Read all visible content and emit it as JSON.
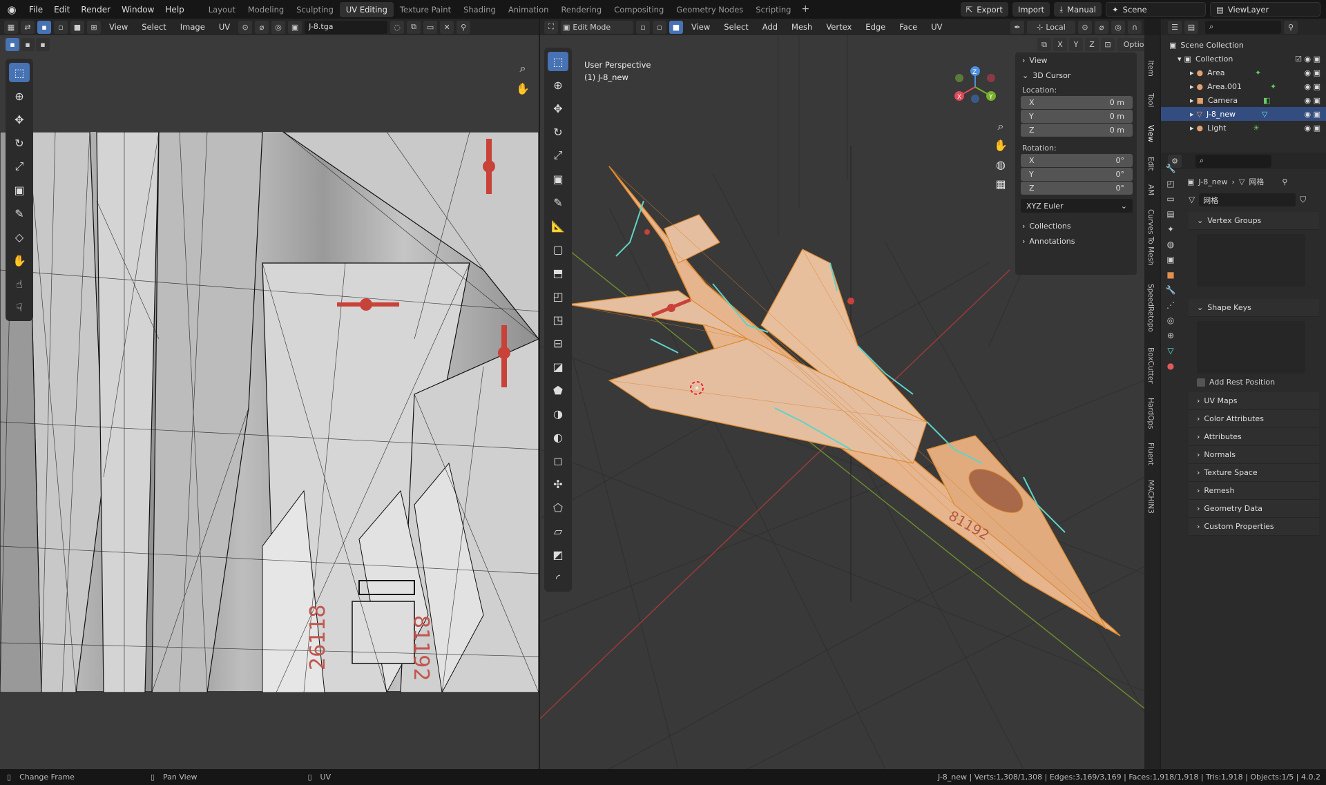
{
  "topbar": {
    "menus": [
      "File",
      "Edit",
      "Render",
      "Window",
      "Help"
    ],
    "workspaces": [
      "Layout",
      "Modeling",
      "Sculpting",
      "UV Editing",
      "Texture Paint",
      "Shading",
      "Animation",
      "Rendering",
      "Compositing",
      "Geometry Nodes",
      "Scripting"
    ],
    "active_workspace": "UV Editing",
    "plus": "+",
    "export": "Export",
    "import": "Import",
    "manual": "Manual",
    "scene": "Scene",
    "viewlayer": "ViewLayer"
  },
  "uv_editor": {
    "menus": [
      "View",
      "Select",
      "Image",
      "UV"
    ],
    "image_name": "J-8.tga"
  },
  "viewport": {
    "mode": "Edit Mode",
    "menus": [
      "View",
      "Select",
      "Add",
      "Mesh",
      "Vertex",
      "Edge",
      "Face",
      "UV"
    ],
    "transform": "Local",
    "options": "Options",
    "axes": [
      "X",
      "Y",
      "Z"
    ],
    "perspective": "User Perspective",
    "object_label": "(1) J-8_new",
    "npanel": {
      "view": "View",
      "cursor": "3D Cursor",
      "location_label": "Location:",
      "location": [
        {
          "axis": "X",
          "value": "0 m"
        },
        {
          "axis": "Y",
          "value": "0 m"
        },
        {
          "axis": "Z",
          "value": "0 m"
        }
      ],
      "rotation_label": "Rotation:",
      "rotation": [
        {
          "axis": "X",
          "value": "0°"
        },
        {
          "axis": "Y",
          "value": "0°"
        },
        {
          "axis": "Z",
          "value": "0°"
        }
      ],
      "rotation_mode": "XYZ Euler",
      "collections": "Collections",
      "annotations": "Annotations"
    },
    "side_tabs": [
      "Item",
      "Tool",
      "View",
      "Edit",
      "AM",
      "Curves To Mesh",
      "SpeedRetopo",
      "BoxCutter",
      "HardOps",
      "Fluent",
      "MACHIN3"
    ]
  },
  "outliner": {
    "scene_collection": "Scene Collection",
    "collection": "Collection",
    "items": [
      "Area",
      "Area.001",
      "Camera",
      "J-8_new",
      "Light"
    ],
    "selected": "J-8_new"
  },
  "properties": {
    "breadcrumb_object": "J-8_new",
    "breadcrumb_data": "网格",
    "mesh_name": "网格",
    "sections": [
      "UV Maps",
      "Color Attributes",
      "Attributes",
      "Normals",
      "Texture Space",
      "Remesh",
      "Geometry Data",
      "Custom Properties"
    ],
    "vertex_groups": "Vertex Groups",
    "shape_keys": "Shape Keys",
    "add_rest_position": "Add Rest Position"
  },
  "statusbar": {
    "change_frame": "Change Frame",
    "pan_view": "Pan View",
    "uv": "UV",
    "stats": "J-8_new | Verts:1,308/1,308 | Edges:3,169/3,169 | Faces:1,918/1,918 | Tris:1,918 | Objects:1/5 | 4.0.2"
  },
  "colors": {
    "accent": "#4772b3",
    "selection": "#e8963a",
    "edge_seam": "#5fd3c8"
  }
}
